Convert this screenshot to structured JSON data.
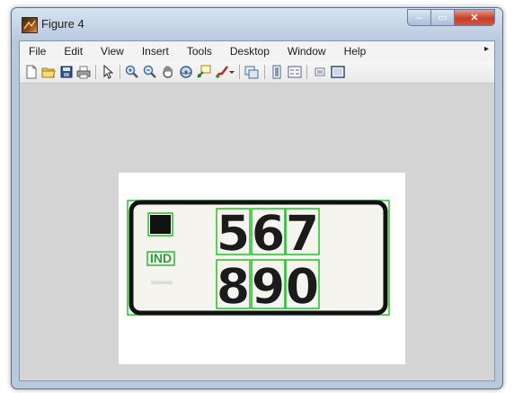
{
  "window": {
    "title": "Figure 4",
    "min_glyph": "–",
    "max_glyph": "▭",
    "close_glyph": "✕"
  },
  "menu": {
    "items": [
      "File",
      "Edit",
      "View",
      "Insert",
      "Tools",
      "Desktop",
      "Window",
      "Help"
    ],
    "overflow_glyph": "▸"
  },
  "toolbar": {
    "icons": [
      "new-figure-icon",
      "open-file-icon",
      "save-icon",
      "print-icon",
      "edit-plot-arrow-icon",
      "zoom-in-icon",
      "zoom-out-icon",
      "pan-hand-icon",
      "rotate-3d-icon",
      "data-cursor-icon",
      "brush-icon",
      "brush-dropdown-icon",
      "link-plot-icon",
      "colorbar-icon",
      "legend-icon",
      "hide-plot-tools-icon",
      "show-plot-tools-icon"
    ]
  },
  "figure": {
    "plate_text": {
      "country_code": "IND",
      "row1": [
        "5",
        "6",
        "7"
      ],
      "row2": [
        "8",
        "9",
        "0"
      ],
      "small_text": "xxxxxxxx"
    },
    "colors": {
      "detection_box": "#22c02a",
      "plate_border": "#111111",
      "plate_background": "#f6f4ef",
      "country_code": "#2b9a3a"
    }
  }
}
